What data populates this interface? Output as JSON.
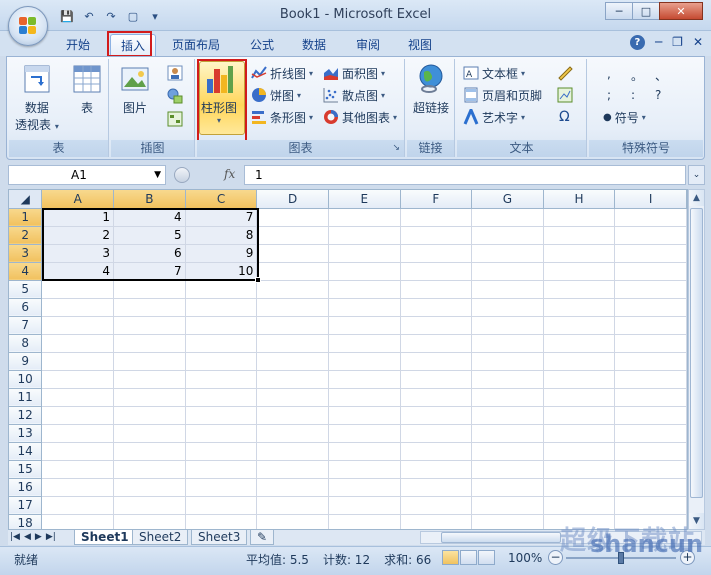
{
  "window": {
    "title": "Book1 - Microsoft Excel",
    "minimize": "─",
    "maximize": "□",
    "close": "✕"
  },
  "qat": {
    "save": "💾",
    "undo": "↶",
    "redo": "↷",
    "preview": "▢"
  },
  "tabs": [
    {
      "label": "开始"
    },
    {
      "label": "插入"
    },
    {
      "label": "页面布局"
    },
    {
      "label": "公式"
    },
    {
      "label": "数据"
    },
    {
      "label": "审阅"
    },
    {
      "label": "视图"
    }
  ],
  "active_tab": "插入",
  "ribbon": {
    "groups": {
      "tables": "表",
      "illustrations": "插图",
      "charts": "图表",
      "links": "链接",
      "text": "文本",
      "symbols": "特殊符号"
    },
    "pivot_line1": "数据",
    "pivot_line2": "透视表",
    "table": "表",
    "picture": "图片",
    "column_chart": "柱形图",
    "line_chart": "折线图",
    "pie_chart": "饼图",
    "bar_chart": "条形图",
    "area_chart": "面积图",
    "scatter_chart": "散点图",
    "other_chart": "其他图表",
    "hyperlink": "超链接",
    "textbox": "文本框",
    "header_footer": "页眉和页脚",
    "wordart": "艺术字",
    "symbol": "符号",
    "omega": "Ω",
    "punct": [
      ",",
      "。",
      "、",
      ";",
      ":",
      "?"
    ]
  },
  "formula_bar": {
    "name_box": "A1",
    "fx": "fx",
    "content": "1"
  },
  "columns": [
    "A",
    "B",
    "C",
    "D",
    "E",
    "F",
    "G",
    "H",
    "I"
  ],
  "rows": [
    {
      "n": "1",
      "a": "1",
      "b": "4",
      "c": "7"
    },
    {
      "n": "2",
      "a": "2",
      "b": "5",
      "c": "8"
    },
    {
      "n": "3",
      "a": "3",
      "b": "6",
      "c": "9"
    },
    {
      "n": "4",
      "a": "4",
      "b": "7",
      "c": "10"
    },
    {
      "n": "5"
    },
    {
      "n": "6"
    },
    {
      "n": "7"
    },
    {
      "n": "8"
    },
    {
      "n": "9"
    },
    {
      "n": "10"
    },
    {
      "n": "11"
    },
    {
      "n": "12"
    },
    {
      "n": "13"
    },
    {
      "n": "14"
    },
    {
      "n": "15"
    },
    {
      "n": "16"
    },
    {
      "n": "17"
    },
    {
      "n": "18"
    }
  ],
  "sheets": [
    "Sheet1",
    "Sheet2",
    "Sheet3"
  ],
  "status": {
    "ready": "就绪",
    "average": "平均值: 5.5",
    "count": "计数: 12",
    "sum": "求和: 66",
    "zoom": "100%"
  },
  "watermark": "shancun",
  "watermark_cn": "超级下载站"
}
